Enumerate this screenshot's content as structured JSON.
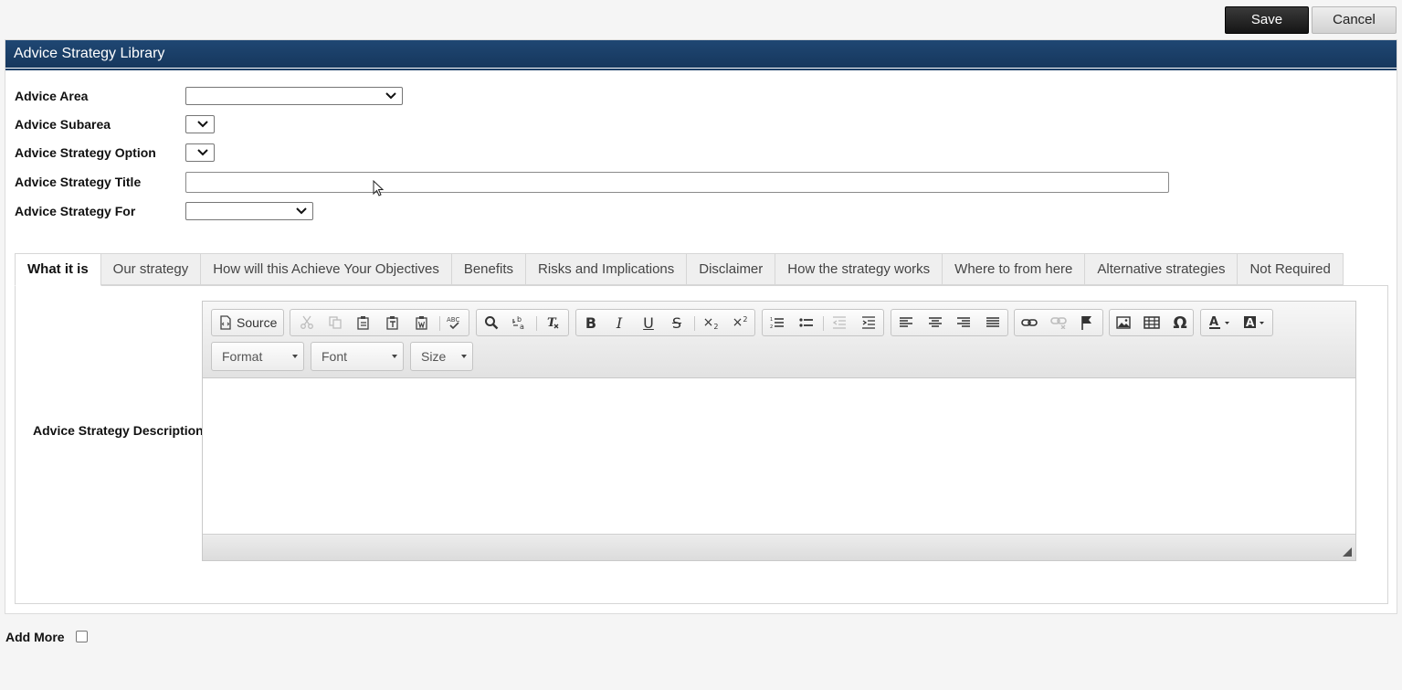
{
  "actions": {
    "save_label": "Save",
    "cancel_label": "Cancel"
  },
  "panel": {
    "title": "Advice Strategy Library"
  },
  "form": {
    "advice_area_label": "Advice Area",
    "advice_subarea_label": "Advice Subarea",
    "advice_strategy_option_label": "Advice Strategy Option",
    "advice_strategy_title_label": "Advice Strategy Title",
    "advice_strategy_title_value": "",
    "advice_strategy_for_label": "Advice Strategy For"
  },
  "tabs": [
    {
      "label": "What it is"
    },
    {
      "label": "Our strategy"
    },
    {
      "label": "How will this Achieve Your Objectives"
    },
    {
      "label": "Benefits"
    },
    {
      "label": "Risks and Implications"
    },
    {
      "label": "Disclaimer"
    },
    {
      "label": "How the strategy works"
    },
    {
      "label": "Where to from here"
    },
    {
      "label": "Alternative strategies"
    },
    {
      "label": "Not Required"
    }
  ],
  "active_tab": "What it is",
  "description": {
    "label": "Advice Strategy Description"
  },
  "editor": {
    "source_label": "Source",
    "format_label": "Format",
    "font_label": "Font",
    "size_label": "Size",
    "icons": [
      "source-icon",
      "cut-icon",
      "copy-icon",
      "paste-icon",
      "paste-text-icon",
      "paste-word-icon",
      "spellcheck-icon",
      "find-icon",
      "replace-icon",
      "remove-format-icon",
      "bold-icon",
      "italic-icon",
      "underline-icon",
      "strikethrough-icon",
      "subscript-icon",
      "superscript-icon",
      "numbered-list-icon",
      "bulleted-list-icon",
      "outdent-icon",
      "indent-icon",
      "align-left-icon",
      "align-center-icon",
      "align-right-icon",
      "justify-icon",
      "link-icon",
      "unlink-icon",
      "anchor-icon",
      "image-icon",
      "table-icon",
      "special-char-icon",
      "text-color-icon",
      "bg-color-icon"
    ]
  },
  "add_more": {
    "label": "Add More",
    "checked": false
  }
}
